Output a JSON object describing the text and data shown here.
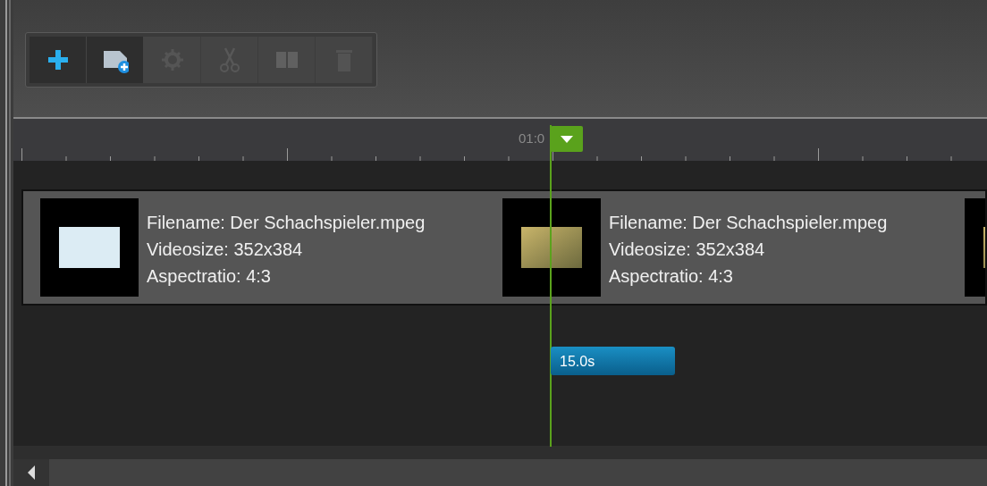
{
  "toolbar": [
    {
      "kind": "plus",
      "enabled": true
    },
    {
      "kind": "media-add",
      "enabled": true
    },
    {
      "kind": "gear",
      "enabled": false
    },
    {
      "kind": "scissors",
      "enabled": false
    },
    {
      "kind": "film",
      "enabled": false
    },
    {
      "kind": "trash",
      "enabled": false
    }
  ],
  "ruler": {
    "label": "01:0"
  },
  "clips": [
    {
      "kind": "slide",
      "filename": "Filename: Der Schachspieler.mpeg",
      "videosize": "Videosize: 352x384",
      "aspect": "Aspectratio: 4:3"
    },
    {
      "kind": "photo",
      "filename": "Filename: Der Schachspieler.mpeg",
      "videosize": "Videosize: 352x384",
      "aspect": "Aspectratio: 4:3"
    },
    {
      "kind": "photo"
    }
  ],
  "duration": {
    "label": "15.0s"
  }
}
